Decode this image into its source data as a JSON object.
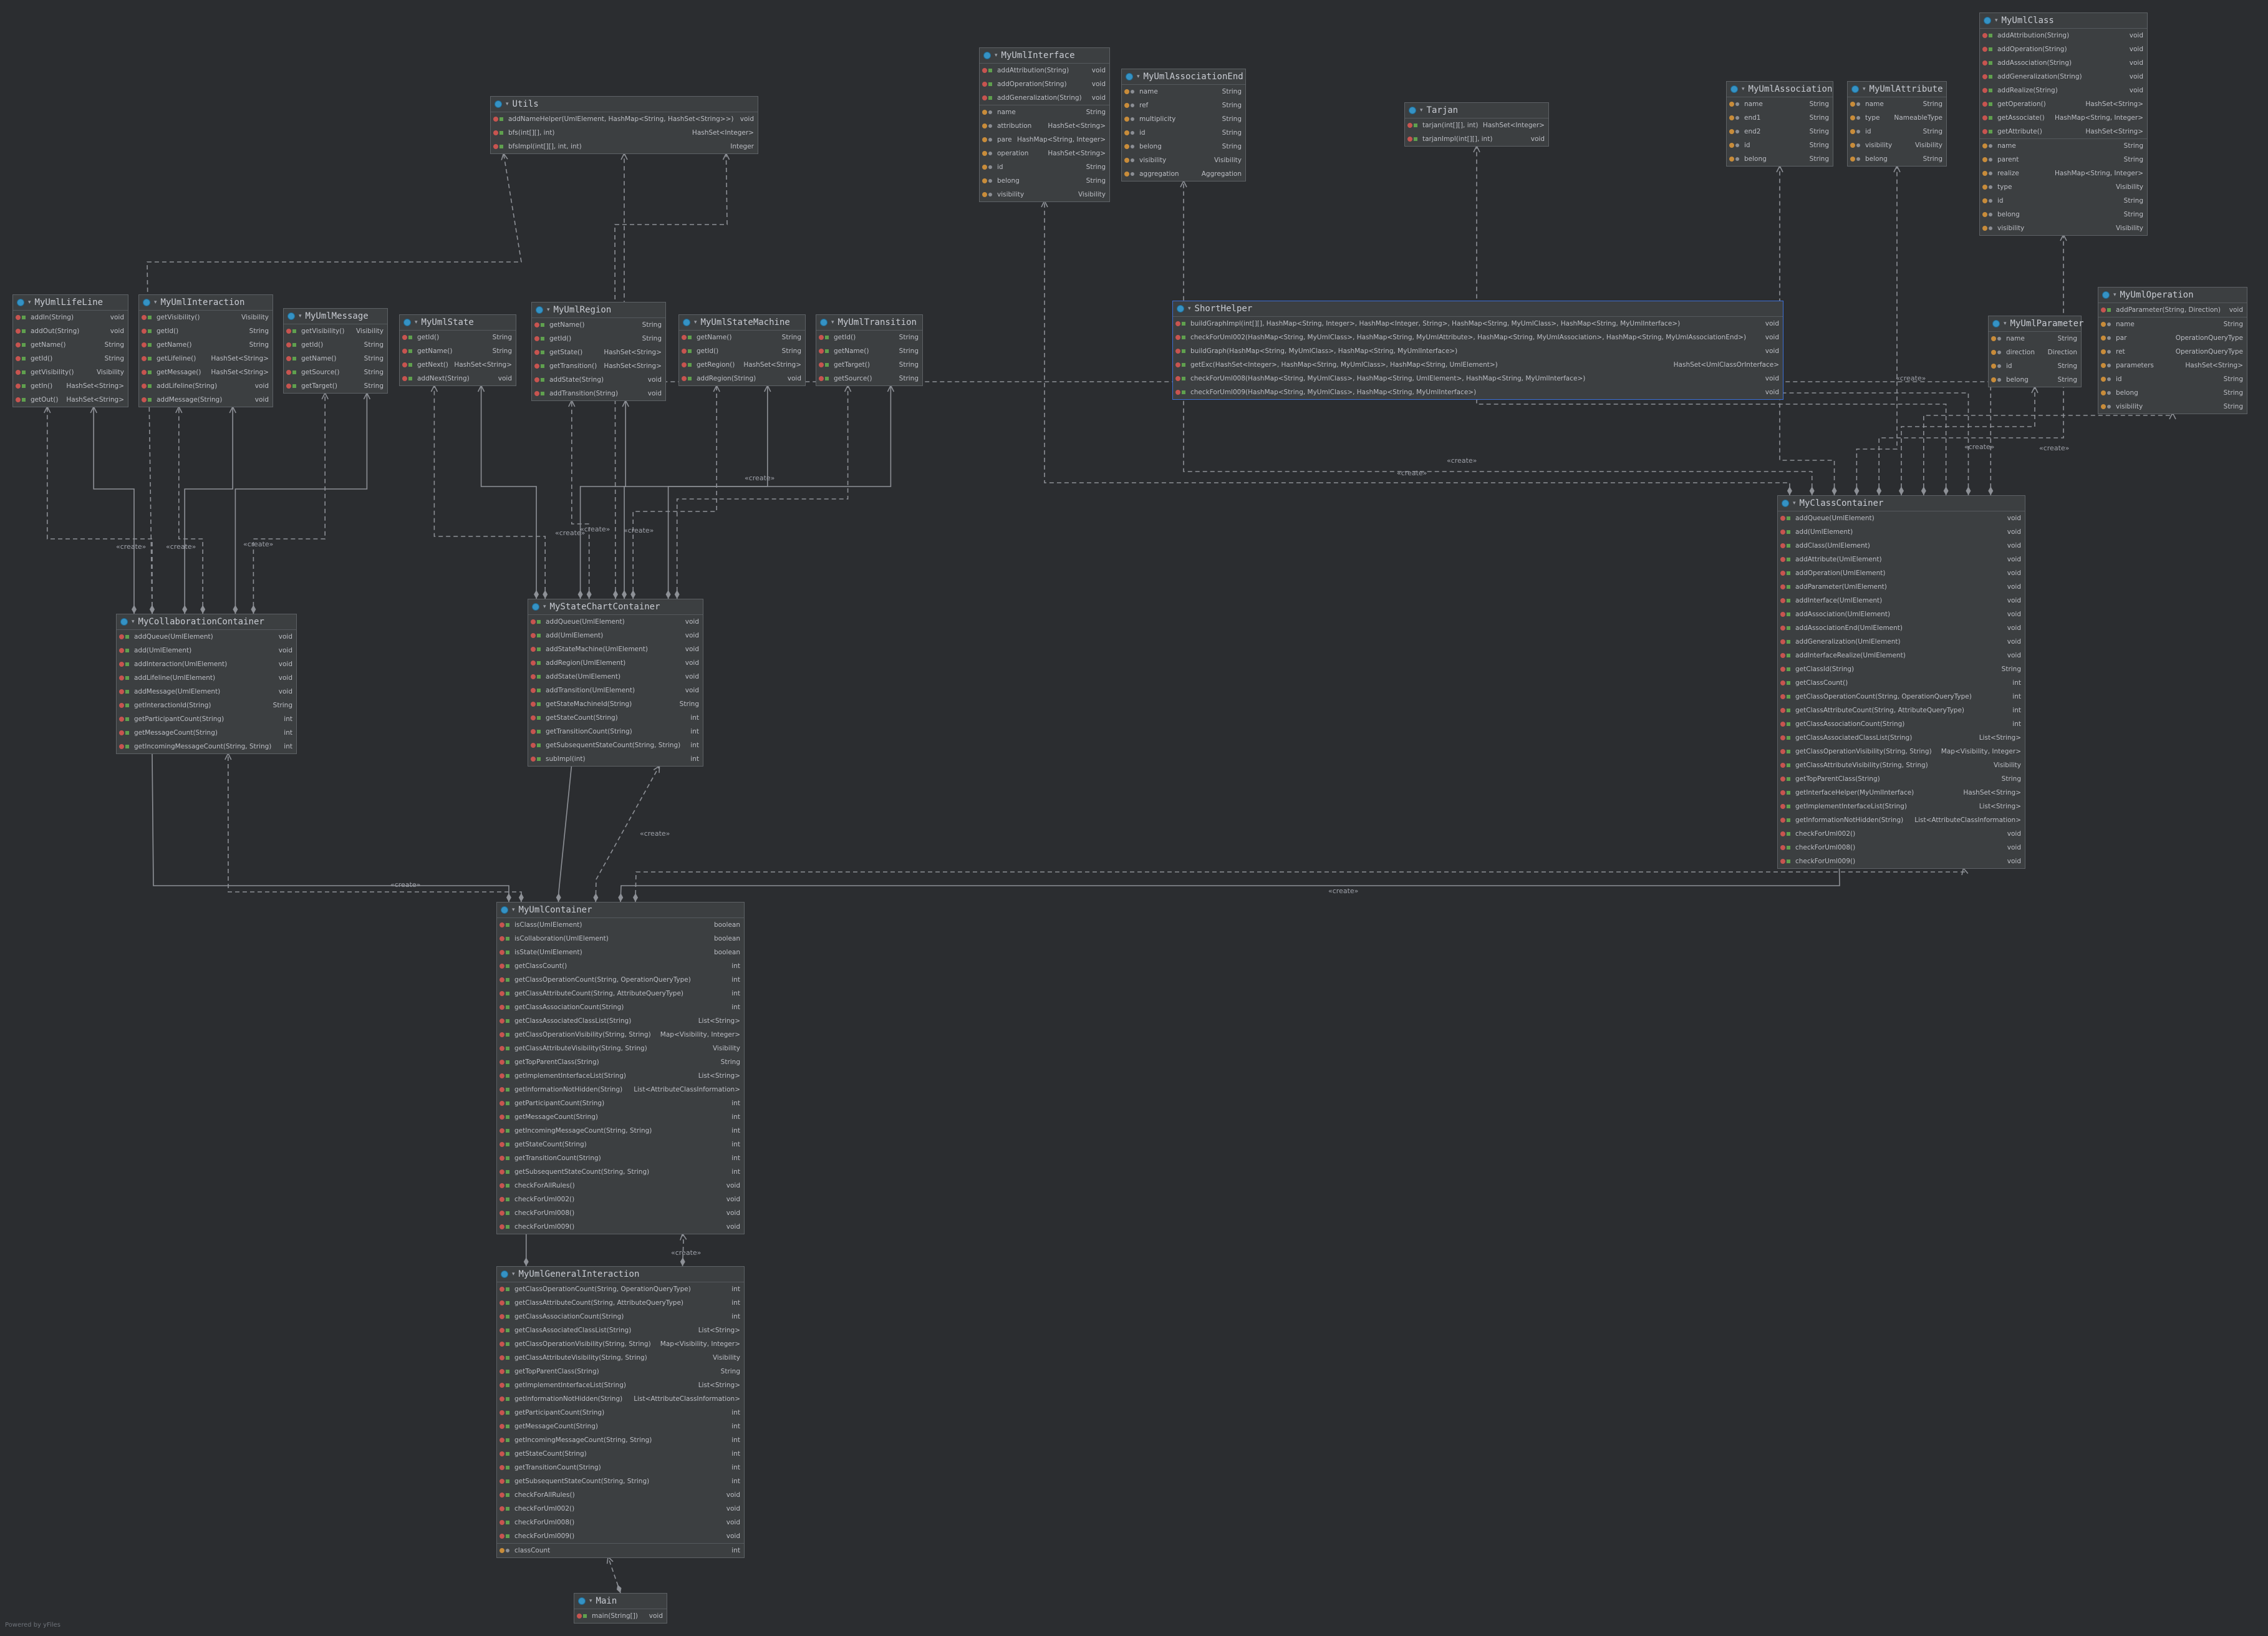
{
  "footer": "Powered by yFiles",
  "create_label": "«create»",
  "classes": [
    {
      "id": "utils",
      "name": "Utils",
      "methods": [
        [
          "addNameHelper(UmlElement, HashMap<String, HashSet<String>>)",
          "void"
        ],
        [
          "bfs(int[][], int)",
          "HashSet<Integer>"
        ],
        [
          "bfsImpl(int[][], int, int)",
          "Integer"
        ]
      ],
      "fields": []
    },
    {
      "id": "myumlinterface",
      "name": "MyUmlInterface",
      "methods": [
        [
          "addAttribution(String)",
          "void"
        ],
        [
          "addOperation(String)",
          "void"
        ],
        [
          "addGeneralization(String)",
          "void"
        ]
      ],
      "fields": [
        [
          "name",
          "String"
        ],
        [
          "attribution",
          "HashSet<String>"
        ],
        [
          "parent",
          "HashMap<String, Integer>"
        ],
        [
          "operation",
          "HashSet<String>"
        ],
        [
          "id",
          "String"
        ],
        [
          "belong",
          "String"
        ],
        [
          "visibility",
          "Visibility"
        ]
      ]
    },
    {
      "id": "myumlassociationend",
      "name": "MyUmlAssociationEnd",
      "methods": [],
      "fields": [
        [
          "name",
          "String"
        ],
        [
          "ref",
          "String"
        ],
        [
          "multiplicity",
          "String"
        ],
        [
          "id",
          "String"
        ],
        [
          "belong",
          "String"
        ],
        [
          "visibility",
          "Visibility"
        ],
        [
          "aggregation",
          "Aggregation"
        ]
      ]
    },
    {
      "id": "tarjan",
      "name": "Tarjan",
      "methods": [
        [
          "tarjan(int[][], int)",
          "HashSet<Integer>"
        ],
        [
          "tarjanImpl(int[][], int)",
          "void"
        ]
      ],
      "fields": []
    },
    {
      "id": "myumlassociation",
      "name": "MyUmlAssociation",
      "methods": [],
      "fields": [
        [
          "name",
          "String"
        ],
        [
          "end1",
          "String"
        ],
        [
          "end2",
          "String"
        ],
        [
          "id",
          "String"
        ],
        [
          "belong",
          "String"
        ]
      ]
    },
    {
      "id": "myumlattribute",
      "name": "MyUmlAttribute",
      "methods": [],
      "fields": [
        [
          "name",
          "String"
        ],
        [
          "type",
          "NameableType"
        ],
        [
          "id",
          "String"
        ],
        [
          "visibility",
          "Visibility"
        ],
        [
          "belong",
          "String"
        ]
      ]
    },
    {
      "id": "myumlclass",
      "name": "MyUmlClass",
      "methods": [
        [
          "addAttribution(String)",
          "void"
        ],
        [
          "addOperation(String)",
          "void"
        ],
        [
          "addAssociation(String)",
          "void"
        ],
        [
          "addGeneralization(String)",
          "void"
        ],
        [
          "addRealize(String)",
          "void"
        ],
        [
          "getOperation()",
          "HashSet<String>"
        ],
        [
          "getAssociate()",
          "HashMap<String, Integer>"
        ],
        [
          "getAttribute()",
          "HashSet<String>"
        ]
      ],
      "fields": [
        [
          "name",
          "String"
        ],
        [
          "parent",
          "String"
        ],
        [
          "realize",
          "HashMap<String, Integer>"
        ],
        [
          "type",
          "Visibility"
        ],
        [
          "id",
          "String"
        ],
        [
          "belong",
          "String"
        ],
        [
          "visibility",
          "Visibility"
        ]
      ]
    },
    {
      "id": "myumllifeline",
      "name": "MyUmlLifeLine",
      "methods": [
        [
          "addIn(String)",
          "void"
        ],
        [
          "addOut(String)",
          "void"
        ],
        [
          "getName()",
          "String"
        ],
        [
          "getId()",
          "String"
        ],
        [
          "getVisibility()",
          "Visibility"
        ],
        [
          "getIn()",
          "HashSet<String>"
        ],
        [
          "getOut()",
          "HashSet<String>"
        ]
      ],
      "fields": []
    },
    {
      "id": "myumlinteraction",
      "name": "MyUmlInteraction",
      "methods": [
        [
          "getVisibility()",
          "Visibility"
        ],
        [
          "getId()",
          "String"
        ],
        [
          "getName()",
          "String"
        ],
        [
          "getLifeline()",
          "HashSet<String>"
        ],
        [
          "getMessage()",
          "HashSet<String>"
        ],
        [
          "addLifeline(String)",
          "void"
        ],
        [
          "addMessage(String)",
          "void"
        ]
      ],
      "fields": []
    },
    {
      "id": "myumlmessage",
      "name": "MyUmlMessage",
      "methods": [
        [
          "getVisibility()",
          "Visibility"
        ],
        [
          "getId()",
          "String"
        ],
        [
          "getName()",
          "String"
        ],
        [
          "getSource()",
          "String"
        ],
        [
          "getTarget()",
          "String"
        ]
      ],
      "fields": []
    },
    {
      "id": "myumlstate",
      "name": "MyUmlState",
      "methods": [
        [
          "getId()",
          "String"
        ],
        [
          "getName()",
          "String"
        ],
        [
          "getNext()",
          "HashSet<String>"
        ],
        [
          "addNext(String)",
          "void"
        ]
      ],
      "fields": []
    },
    {
      "id": "myumlregion",
      "name": "MyUmlRegion",
      "methods": [
        [
          "getName()",
          "String"
        ],
        [
          "getId()",
          "String"
        ],
        [
          "getState()",
          "HashSet<String>"
        ],
        [
          "getTransition()",
          "HashSet<String>"
        ],
        [
          "addState(String)",
          "void"
        ],
        [
          "addTransition(String)",
          "void"
        ]
      ],
      "fields": []
    },
    {
      "id": "myumlstatemachine",
      "name": "MyUmlStateMachine",
      "methods": [
        [
          "getName()",
          "String"
        ],
        [
          "getId()",
          "String"
        ],
        [
          "getRegion()",
          "HashSet<String>"
        ],
        [
          "addRegion(String)",
          "void"
        ]
      ],
      "fields": []
    },
    {
      "id": "myumltransition",
      "name": "MyUmlTransition",
      "methods": [
        [
          "getId()",
          "String"
        ],
        [
          "getName()",
          "String"
        ],
        [
          "getTarget()",
          "String"
        ],
        [
          "getSource()",
          "String"
        ]
      ],
      "fields": []
    },
    {
      "id": "shorthelper",
      "name": "ShortHelper",
      "methods": [
        [
          "buildGraphImpl(int[][], HashMap<String, Integer>, HashMap<Integer, String>, HashMap<String, MyUmlClass>, HashMap<String, MyUmlInterface>)",
          "void"
        ],
        [
          "checkForUml002(HashMap<String, MyUmlClass>, HashMap<String, MyUmlAttribute>, HashMap<String, MyUmlAssociation>, HashMap<String, MyUmlAssociationEnd>)",
          "void"
        ],
        [
          "buildGraph(HashMap<String, MyUmlClass>, HashMap<String, MyUmlInterface>)",
          "void"
        ],
        [
          "getExc(HashSet<Integer>, HashMap<String, MyUmlClass>, HashMap<String, UmlElement>)",
          "HashSet<UmlClassOrInterface>"
        ],
        [
          "checkForUml008(HashMap<String, MyUmlClass>, HashMap<String, UmlElement>, HashMap<String, MyUmlInterface>)",
          "void"
        ],
        [
          "checkForUml009(HashMap<String, MyUmlClass>, HashMap<String, MyUmlInterface>)",
          "void"
        ]
      ],
      "fields": []
    },
    {
      "id": "myumlparameter",
      "name": "MyUmlParameter",
      "methods": [],
      "fields": [
        [
          "name",
          "String"
        ],
        [
          "direction",
          "Direction"
        ],
        [
          "id",
          "String"
        ],
        [
          "belong",
          "String"
        ]
      ]
    },
    {
      "id": "myumloperation",
      "name": "MyUmlOperation",
      "methods": [
        [
          "addParameter(String, Direction)",
          "void"
        ]
      ],
      "fields": [
        [
          "name",
          "String"
        ],
        [
          "par",
          "OperationQueryType"
        ],
        [
          "ret",
          "OperationQueryType"
        ],
        [
          "parameters",
          "HashSet<String>"
        ],
        [
          "id",
          "String"
        ],
        [
          "belong",
          "String"
        ],
        [
          "visibility",
          "String"
        ]
      ]
    },
    {
      "id": "myclasscontainer",
      "name": "MyClassContainer",
      "methods": [
        [
          "addQueue(UmlElement)",
          "void"
        ],
        [
          "add(UmlElement)",
          "void"
        ],
        [
          "addClass(UmlElement)",
          "void"
        ],
        [
          "addAttribute(UmlElement)",
          "void"
        ],
        [
          "addOperation(UmlElement)",
          "void"
        ],
        [
          "addParameter(UmlElement)",
          "void"
        ],
        [
          "addInterface(UmlElement)",
          "void"
        ],
        [
          "addAssociation(UmlElement)",
          "void"
        ],
        [
          "addAssociationEnd(UmlElement)",
          "void"
        ],
        [
          "addGeneralization(UmlElement)",
          "void"
        ],
        [
          "addInterfaceRealize(UmlElement)",
          "void"
        ],
        [
          "getClassId(String)",
          "String"
        ],
        [
          "getClassCount()",
          "int"
        ],
        [
          "getClassOperationCount(String, OperationQueryType)",
          "int"
        ],
        [
          "getClassAttributeCount(String, AttributeQueryType)",
          "int"
        ],
        [
          "getClassAssociationCount(String)",
          "int"
        ],
        [
          "getClassAssociatedClassList(String)",
          "List<String>"
        ],
        [
          "getClassOperationVisibility(String, String)",
          "Map<Visibility, Integer>"
        ],
        [
          "getClassAttributeVisibility(String, String)",
          "Visibility"
        ],
        [
          "getTopParentClass(String)",
          "String"
        ],
        [
          "getInterfaceHelper(MyUmlInterface)",
          "HashSet<String>"
        ],
        [
          "getImplementInterfaceList(String)",
          "List<String>"
        ],
        [
          "getInformationNotHidden(String)",
          "List<AttributeClassInformation>"
        ],
        [
          "checkForUml002()",
          "void"
        ],
        [
          "checkForUml008()",
          "void"
        ],
        [
          "checkForUml009()",
          "void"
        ]
      ],
      "fields": []
    },
    {
      "id": "mycollaborationcontainer",
      "name": "MyCollaborationContainer",
      "methods": [
        [
          "addQueue(UmlElement)",
          "void"
        ],
        [
          "add(UmlElement)",
          "void"
        ],
        [
          "addInteraction(UmlElement)",
          "void"
        ],
        [
          "addLifeline(UmlElement)",
          "void"
        ],
        [
          "addMessage(UmlElement)",
          "void"
        ],
        [
          "getInteractionId(String)",
          "String"
        ],
        [
          "getParticipantCount(String)",
          "int"
        ],
        [
          "getMessageCount(String)",
          "int"
        ],
        [
          "getIncomingMessageCount(String, String)",
          "int"
        ]
      ],
      "fields": []
    },
    {
      "id": "mystatechartcontainer",
      "name": "MyStateChartContainer",
      "methods": [
        [
          "addQueue(UmlElement)",
          "void"
        ],
        [
          "add(UmlElement)",
          "void"
        ],
        [
          "addStateMachine(UmlElement)",
          "void"
        ],
        [
          "addRegion(UmlElement)",
          "void"
        ],
        [
          "addState(UmlElement)",
          "void"
        ],
        [
          "addTransition(UmlElement)",
          "void"
        ],
        [
          "getStateMachineId(String)",
          "String"
        ],
        [
          "getStateCount(String)",
          "int"
        ],
        [
          "getTransitionCount(String)",
          "int"
        ],
        [
          "getSubsequentStateCount(String, String)",
          "int"
        ],
        [
          "subImpl(int)",
          "int"
        ]
      ],
      "fields": []
    },
    {
      "id": "myumlcontainer",
      "name": "MyUmlContainer",
      "methods": [
        [
          "isClass(UmlElement)",
          "boolean"
        ],
        [
          "isCollaboration(UmlElement)",
          "boolean"
        ],
        [
          "isState(UmlElement)",
          "boolean"
        ],
        [
          "getClassCount()",
          "int"
        ],
        [
          "getClassOperationCount(String, OperationQueryType)",
          "int"
        ],
        [
          "getClassAttributeCount(String, AttributeQueryType)",
          "int"
        ],
        [
          "getClassAssociationCount(String)",
          "int"
        ],
        [
          "getClassAssociatedClassList(String)",
          "List<String>"
        ],
        [
          "getClassOperationVisibility(String, String)",
          "Map<Visibility, Integer>"
        ],
        [
          "getClassAttributeVisibility(String, String)",
          "Visibility"
        ],
        [
          "getTopParentClass(String)",
          "String"
        ],
        [
          "getImplementInterfaceList(String)",
          "List<String>"
        ],
        [
          "getInformationNotHidden(String)",
          "List<AttributeClassInformation>"
        ],
        [
          "getParticipantCount(String)",
          "int"
        ],
        [
          "getMessageCount(String)",
          "int"
        ],
        [
          "getIncomingMessageCount(String, String)",
          "int"
        ],
        [
          "getStateCount(String)",
          "int"
        ],
        [
          "getTransitionCount(String)",
          "int"
        ],
        [
          "getSubsequentStateCount(String, String)",
          "int"
        ],
        [
          "checkForAllRules()",
          "void"
        ],
        [
          "checkForUml002()",
          "void"
        ],
        [
          "checkForUml008()",
          "void"
        ],
        [
          "checkForUml009()",
          "void"
        ]
      ],
      "fields": []
    },
    {
      "id": "myumlgeneralinteraction",
      "name": "MyUmlGeneralInteraction",
      "methods": [
        [
          "getClassOperationCount(String, OperationQueryType)",
          "int"
        ],
        [
          "getClassAttributeCount(String, AttributeQueryType)",
          "int"
        ],
        [
          "getClassAssociationCount(String)",
          "int"
        ],
        [
          "getClassAssociatedClassList(String)",
          "List<String>"
        ],
        [
          "getClassOperationVisibility(String, String)",
          "Map<Visibility, Integer>"
        ],
        [
          "getClassAttributeVisibility(String, String)",
          "Visibility"
        ],
        [
          "getTopParentClass(String)",
          "String"
        ],
        [
          "getImplementInterfaceList(String)",
          "List<String>"
        ],
        [
          "getInformationNotHidden(String)",
          "List<AttributeClassInformation>"
        ],
        [
          "getParticipantCount(String)",
          "int"
        ],
        [
          "getMessageCount(String)",
          "int"
        ],
        [
          "getIncomingMessageCount(String, String)",
          "int"
        ],
        [
          "getStateCount(String)",
          "int"
        ],
        [
          "getTransitionCount(String)",
          "int"
        ],
        [
          "getSubsequentStateCount(String, String)",
          "int"
        ],
        [
          "checkForAllRules()",
          "void"
        ],
        [
          "checkForUml002()",
          "void"
        ],
        [
          "checkForUml008()",
          "void"
        ],
        [
          "checkForUml009()",
          "void"
        ]
      ],
      "fields": [
        [
          "classCount",
          "int"
        ]
      ]
    },
    {
      "id": "main",
      "name": "Main",
      "methods": [
        [
          "main(String[])",
          "void"
        ]
      ],
      "fields": []
    }
  ]
}
